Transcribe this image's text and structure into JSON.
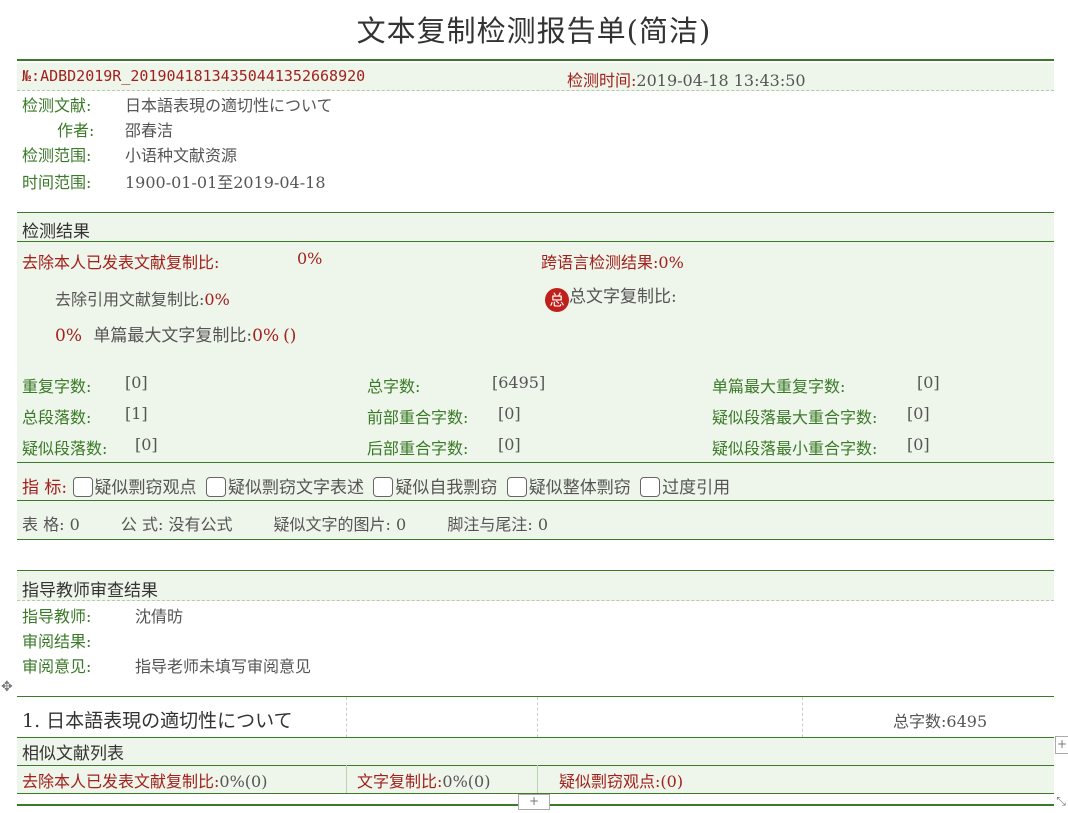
{
  "title": "文本复制检测报告单(简洁)",
  "header": {
    "no_label": "№:",
    "no_value": "ADBD2019R_20190418134350441352668920",
    "time_label": "检测时间:",
    "time_value": "2019-04-18 13:43:50"
  },
  "meta": {
    "doc_label": "检测文献:",
    "doc_value": "日本語表現の適切性について",
    "author_label": "作者:",
    "author_value": "邵春洁",
    "scope_label": "检测范围:",
    "scope_value": "小语种文献资源",
    "time_range_label": "时间范围:",
    "time_range_value": "1900-01-01至2019-04-18"
  },
  "results": {
    "heading": "检测结果",
    "self_excluded_label": "去除本人已发表文献复制比:",
    "self_excluded_value": "0%",
    "cross_lang_label": "跨语言检测结果:",
    "cross_lang_value": "0%",
    "citation_excluded_label": "去除引用文献复制比:",
    "citation_excluded_value": "0%",
    "total_badge": "总",
    "total_copy_label": "总文字复制比:",
    "total_copy_value": "0%",
    "single_max_label": "单篇最大文字复制比:",
    "single_max_value": "0%",
    "single_max_paren": "()",
    "stats": [
      {
        "label": "重复字数:",
        "value": "[0]"
      },
      {
        "label": "总字数:",
        "value": "[6495]"
      },
      {
        "label": "单篇最大重复字数:",
        "value": "[0]"
      },
      {
        "label": "总段落数:",
        "value": "[1]"
      },
      {
        "label": "前部重合字数:",
        "value": "[0]"
      },
      {
        "label": "疑似段落最大重合字数:",
        "value": "[0]"
      },
      {
        "label": "疑似段落数:",
        "value": "[0]"
      },
      {
        "label": "后部重合字数:",
        "value": "[0]"
      },
      {
        "label": "疑似段落最小重合字数:",
        "value": "[0]"
      }
    ],
    "indicator_label": "指 标:",
    "indicators": [
      "疑似剽窃观点",
      "疑似剽窃文字表述",
      "疑似自我剽窃",
      "疑似整体剽窃",
      "过度引用"
    ],
    "table_label": "表 格:",
    "table_value": "0",
    "formula_label": "公 式:",
    "formula_value": "没有公式",
    "image_label": "疑似文字的图片:",
    "image_value": "0",
    "footnote_label": "脚注与尾注:",
    "footnote_value": "0"
  },
  "teacher": {
    "heading": "指导教师审查结果",
    "name_label": "指导教师:",
    "name_value": "沈倩昉",
    "result_label": "审阅结果:",
    "opinion_label": "审阅意见:",
    "opinion_value": "指导老师未填写审阅意见"
  },
  "section": {
    "title": "1. 日本語表現の適切性について",
    "total_words_label": "总字数:",
    "total_words_value": "6495",
    "similar_heading": "相似文献列表",
    "self_excluded_label": "去除本人已发表文献复制比:",
    "self_excluded_value": "0%(0)",
    "copy_ratio_label": "文字复制比:",
    "copy_ratio_value": "0%(0)",
    "plagiarism_label": "疑似剽窃观点:",
    "plagiarism_value": "(0)"
  },
  "colors": {
    "green": "#3a7a28",
    "red": "#a3201c",
    "band": "#eef5ea"
  },
  "icons": [
    "table-move-icon",
    "add-column-icon",
    "add-row-icon",
    "resize-icon"
  ]
}
